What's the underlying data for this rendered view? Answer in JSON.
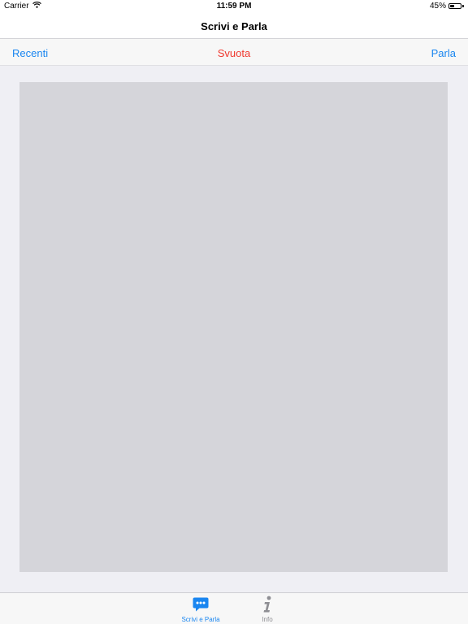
{
  "status_bar": {
    "carrier": "Carrier",
    "time": "11:59 PM",
    "battery_percent": "45%",
    "battery_level": 0.45,
    "wifi_icon": "wifi-icon",
    "battery_icon": "battery-icon"
  },
  "nav_bar": {
    "title": "Scrivi e Parla"
  },
  "toolbar": {
    "recent_label": "Recenti",
    "clear_label": "Svuota",
    "speak_label": "Parla"
  },
  "editor": {
    "value": "",
    "placeholder": ""
  },
  "tab_bar": {
    "tabs": [
      {
        "label": "Scrivi e Parla",
        "icon": "chat-bubble-icon",
        "selected": true
      },
      {
        "label": "Info",
        "icon": "info-icon",
        "selected": false
      }
    ]
  },
  "colors": {
    "accent": "#1a86f0",
    "destructive": "#f0392f",
    "inactive": "#8e8e93",
    "editor_bg": "#d5d5da",
    "background": "#efeff4"
  }
}
